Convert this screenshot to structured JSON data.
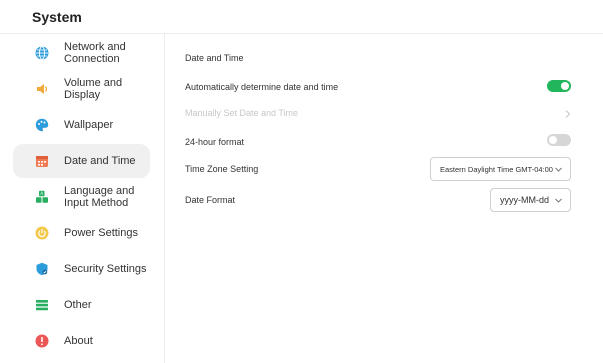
{
  "header": {
    "title": "System"
  },
  "sidebar": {
    "items": [
      {
        "label": "Network and\nConnection",
        "icon": "globe-icon",
        "color": "#2d9cdb"
      },
      {
        "label": "Volume and\nDisplay",
        "icon": "speaker-icon",
        "color": "#f2a93b"
      },
      {
        "label": "Wallpaper",
        "icon": "palette-icon",
        "color": "#2d9cdb"
      },
      {
        "label": "Date and Time",
        "icon": "calendar-icon",
        "color": "#f07b52",
        "active": true
      },
      {
        "label": "Language and\nInput Method",
        "icon": "language-blocks-icon",
        "color": "#27ae60"
      },
      {
        "label": "Power Settings",
        "icon": "power-icon",
        "color": "#f2c94c"
      },
      {
        "label": "Security Settings",
        "icon": "shield-icon",
        "color": "#2d9cdb"
      },
      {
        "label": "Other",
        "icon": "list-icon",
        "color": "#27ae60"
      },
      {
        "label": "About",
        "icon": "info-icon",
        "color": "#eb5757"
      }
    ]
  },
  "main": {
    "section_title": "Date and Time",
    "auto_datetime": {
      "label": "Automatically determine date and time",
      "enabled": true
    },
    "manual_set": {
      "label": "Manually Set Date and Time",
      "disabled": true
    },
    "hour24": {
      "label": "24-hour format",
      "enabled": false
    },
    "timezone": {
      "label": "Time Zone Setting",
      "value": "Eastern Daylight Time GMT-04:00"
    },
    "date_format": {
      "label": "Date Format",
      "value": "yyyy-MM-dd"
    }
  },
  "colors": {
    "toggle_on": "#21b55c",
    "toggle_off": "#d6d6d6",
    "active_bg": "#f0f0f0"
  }
}
